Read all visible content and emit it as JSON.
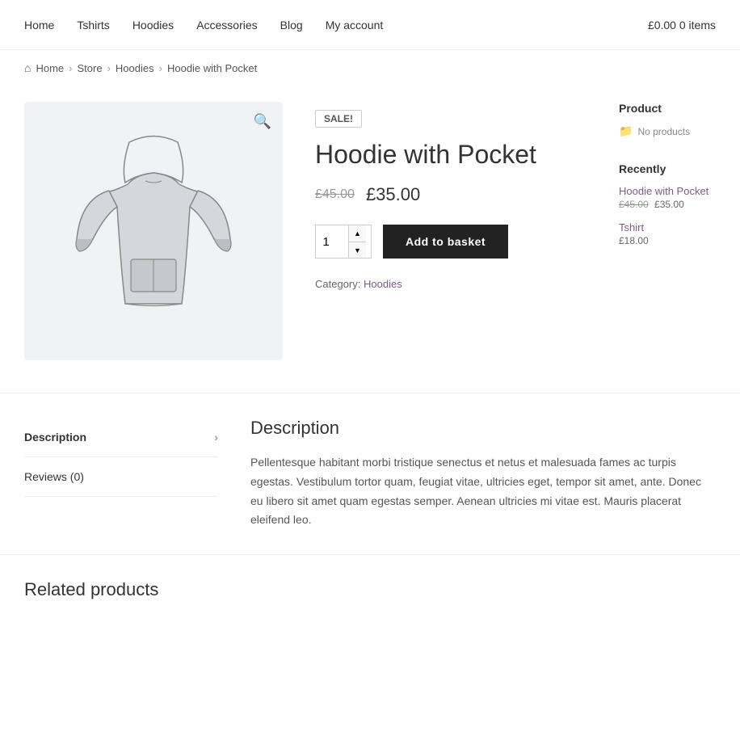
{
  "nav": {
    "items": [
      {
        "label": "Home",
        "href": "#"
      },
      {
        "label": "Tshirts",
        "href": "#"
      },
      {
        "label": "Hoodies",
        "href": "#"
      },
      {
        "label": "Accessories",
        "href": "#"
      },
      {
        "label": "Blog",
        "href": "#"
      },
      {
        "label": "My account",
        "href": "#"
      }
    ]
  },
  "cart": {
    "price": "£0.00",
    "items": "0 items"
  },
  "breadcrumb": {
    "home": "Home",
    "store": "Store",
    "hoodies": "Hoodies",
    "current": "Hoodie with Pocket"
  },
  "product": {
    "sale_badge": "SALE!",
    "title": "Hoodie with Pocket",
    "price_old": "£45.00",
    "price_new": "£35.00",
    "quantity": "1",
    "add_to_basket": "Add to basket",
    "category_label": "Category:",
    "category": "Hoodies"
  },
  "sidebar": {
    "product_section_title": "Product",
    "no_products": "No products",
    "recently_title": "Recently",
    "recently_items": [
      {
        "label": "Hoodie with Pocket",
        "price_old": "£45.00",
        "price_new": "£35.00"
      },
      {
        "label": "Tshirt",
        "price_new": "£18.00"
      }
    ]
  },
  "tabs": {
    "items": [
      {
        "label": "Description",
        "active": true
      },
      {
        "label": "Reviews (0)",
        "active": false
      }
    ]
  },
  "description": {
    "title": "Description",
    "text": "Pellentesque habitant morbi tristique senectus et netus et malesuada fames ac turpis egestas. Vestibulum tortor quam, feugiat vitae, ultricies eget, tempor sit amet, ante. Donec eu libero sit amet quam egestas semper. Aenean ultricies mi vitae est. Mauris placerat eleifend leo."
  },
  "related": {
    "title": "Related products"
  }
}
